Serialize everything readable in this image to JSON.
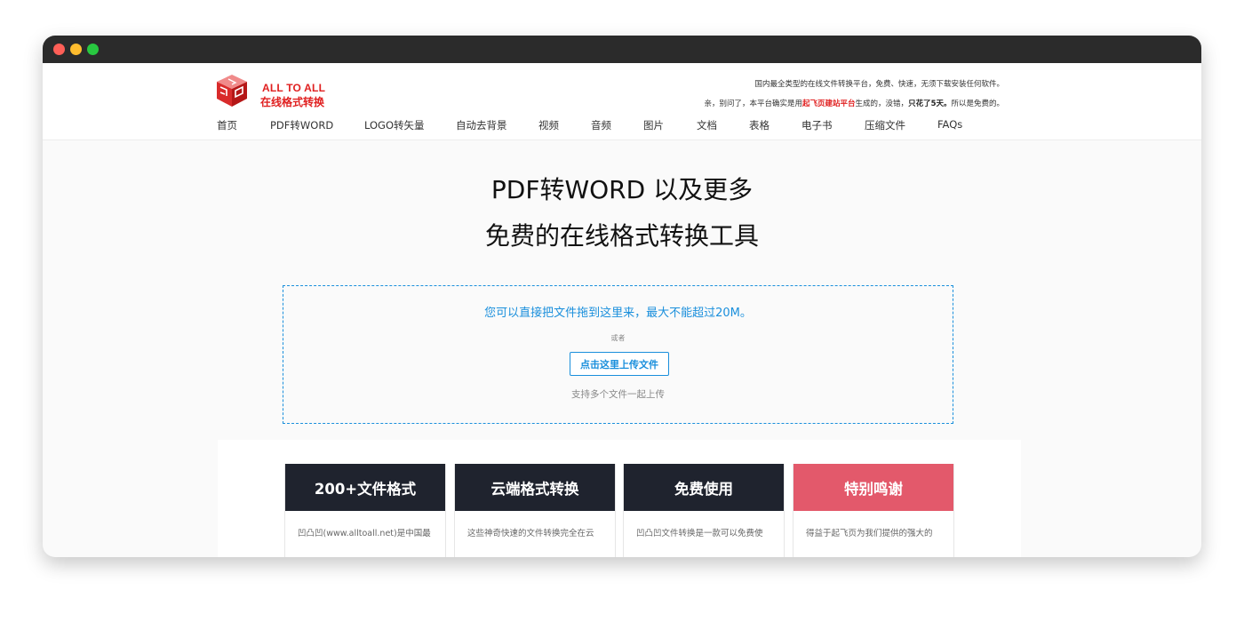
{
  "brand": {
    "name_en": "ALL TO ALL",
    "name_cn": "在线格式转换",
    "primary_color": "#e02020"
  },
  "taglines": {
    "line1": "国内最全类型的在线文件转换平台，免费、快速，无须下载安装任何软件。",
    "line2_prefix": "亲，别问了，本平台确实是用",
    "line2_highlight": "起飞页建站平台",
    "line2_mid": "生成的，没错，",
    "line2_bold": "只花了5天。",
    "line2_suffix": "所以是免费的。"
  },
  "nav": [
    {
      "label": "首页"
    },
    {
      "label": "PDF转WORD"
    },
    {
      "label": "LOGO转矢量"
    },
    {
      "label": "自动去背景"
    },
    {
      "label": "视频"
    },
    {
      "label": "音频"
    },
    {
      "label": "图片"
    },
    {
      "label": "文档"
    },
    {
      "label": "表格"
    },
    {
      "label": "电子书"
    },
    {
      "label": "压缩文件"
    },
    {
      "label": "FAQs"
    }
  ],
  "hero": {
    "line1": "PDF转WORD 以及更多",
    "line2": "免费的在线格式转换工具"
  },
  "upload": {
    "drop_text": "您可以直接把文件拖到这里来，最大不能超过20M。",
    "or_text": "或者",
    "button_label": "点击这里上传文件",
    "multi_text": "支持多个文件一起上传",
    "accent_color": "#1a8fdc"
  },
  "features": [
    {
      "title": "200+文件格式",
      "body": "凹凸凹(www.alltoall.net)是中国最"
    },
    {
      "title": "云端格式转换",
      "body": "这些神奇快速的文件转换完全在云"
    },
    {
      "title": "免费使用",
      "body": "凹凸凹文件转换是一款可以免费使"
    },
    {
      "title": "特别鸣谢",
      "body": "得益于起飞页为我们提供的强大的"
    }
  ],
  "colors": {
    "card_dark": "#1f232e",
    "card_pink": "#e3596b"
  }
}
